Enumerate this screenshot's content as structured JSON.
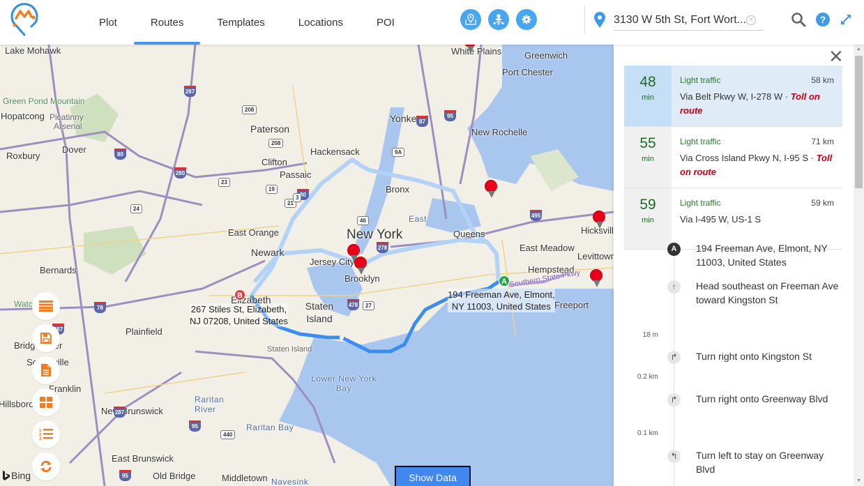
{
  "header": {
    "nav_tabs": [
      {
        "label": "Plot",
        "active": false
      },
      {
        "label": "Routes",
        "active": true
      },
      {
        "label": "Templates",
        "active": false
      },
      {
        "label": "Locations",
        "active": false
      },
      {
        "label": "POI",
        "active": false
      }
    ],
    "tool_buttons": [
      {
        "icon": "map-pin-icon"
      },
      {
        "icon": "user-network-icon"
      },
      {
        "icon": "gear-icon"
      }
    ],
    "search_value": "3130 W 5th St, Fort Wort...",
    "accent_color": "#3f9ae8"
  },
  "map": {
    "labels": {
      "lake_mohawk": "Lake Mohawk",
      "green_pond": "Green Pond Mountain",
      "hopatcong": "Hopatcong",
      "picatinny": "Picatinny",
      "arsenal": "Arsenal",
      "dover": "Dover",
      "roxbury": "Roxbury",
      "paterson": "Paterson",
      "hackensack": "Hackensack",
      "clifton": "Clifton",
      "passaic": "Passaic",
      "yonkers": "Yonkers",
      "white_plains": "White Plains",
      "greenwich": "Greenwich",
      "port_chester": "Port Chester",
      "new_rochelle": "New Rochelle",
      "bronx": "Bronx",
      "east_orange": "East Orange",
      "newark": "Newark",
      "new_york": "New York",
      "jersey_city": "Jersey City",
      "brooklyn": "Brooklyn",
      "east": "East",
      "queens": "Queens",
      "east_meadow": "East Meadow",
      "hicksville": "Hicksville",
      "levittown": "Levittown",
      "hempstead": "Hempstead",
      "freeport": "Freeport",
      "bernards": "Bernards",
      "elizabeth": "Elizabeth",
      "staten_island": "Staten Island",
      "staten_island_small": "Staten Island",
      "plainfield": "Plainfield",
      "bridgewater": "Bridgewater",
      "somerville": "Somerville",
      "franklin": "Franklin",
      "hillsborough": "Hillsborough",
      "new_brunswick": "New Brunswick",
      "raritan_river": "Raritan River",
      "lower_ny_bay": "Lower New York Bay",
      "raritan_bay": "Raritan Bay",
      "east_brunswick": "East Brunswick",
      "old_bridge": "Old Bridge",
      "middletown": "Middletown",
      "navesink": "Navesink",
      "southern_state": "Southern State Pkwy",
      "watchung": "Watchung"
    },
    "shields": {
      "i287a": "287",
      "i287b": "287",
      "i287c": "287",
      "i80a": "80",
      "i80b": "80",
      "i280": "280",
      "i87": "87",
      "i95a": "95",
      "i95b": "95",
      "i95c": "95",
      "i278": "278",
      "i495": "495",
      "i78": "78",
      "i478": "478"
    },
    "state_shields": {
      "r208a": "208",
      "r208b": "208",
      "r23": "23",
      "r19": "19",
      "r21": "21",
      "r9a": "9A",
      "r46": "46",
      "r3": "3",
      "r24": "24",
      "r27": "27",
      "r440": "440"
    },
    "marker_a": "A",
    "marker_b": "B",
    "origin_address": "194 Freeman Ave, Elmont,\nNY 11003, United States",
    "dest_address": "267 Stiles St, Elizabeth,\nNJ 07208, United States",
    "attribution": "Bing",
    "show_data_label": "Show Data",
    "route_color": "#3c8df0",
    "alt_route_color": "#b4d2f7",
    "side_buttons": [
      {
        "name": "menu-button",
        "icon": "hamburger-icon"
      },
      {
        "name": "save-button",
        "icon": "floppy-disk-icon"
      },
      {
        "name": "document-button",
        "icon": "document-icon"
      },
      {
        "name": "grid-button",
        "icon": "grid-icon"
      },
      {
        "name": "numbered-list-button",
        "icon": "numbered-list-icon"
      },
      {
        "name": "refresh-button",
        "icon": "refresh-icon"
      }
    ]
  },
  "panel": {
    "routes": [
      {
        "minutes": "48",
        "unit": "min",
        "traffic": "Light traffic",
        "distance": "58 km",
        "via": "Via Belt Pkwy W, I-278 W",
        "toll": "Toll on route",
        "selected": true
      },
      {
        "minutes": "55",
        "unit": "min",
        "traffic": "Light traffic",
        "distance": "71 km",
        "via": "Via Cross Island Pkwy N, I-95 S",
        "toll": "Toll on route",
        "selected": false
      },
      {
        "minutes": "59",
        "unit": "min",
        "traffic": "Light traffic",
        "distance": "59 km",
        "via": "Via I-495 W, US-1 S",
        "toll": "",
        "selected": false
      }
    ],
    "toll_separator": " · ",
    "steps": [
      {
        "icon": "A",
        "text": "194 Freeman Ave, Elmont, NY 11003, United States"
      },
      {
        "icon": "↑",
        "text": "Head southeast on Freeman Ave toward Kingston St",
        "distance_after": "18 m"
      },
      {
        "icon": "↱",
        "text": "Turn right onto Kingston St",
        "distance_after": "0.2 km"
      },
      {
        "icon": "↱",
        "text": "Turn right onto Greenway Blvd",
        "distance_after": "0.1 km"
      },
      {
        "icon": "↰",
        "text": "Turn left to stay on Greenway Blvd"
      }
    ]
  }
}
